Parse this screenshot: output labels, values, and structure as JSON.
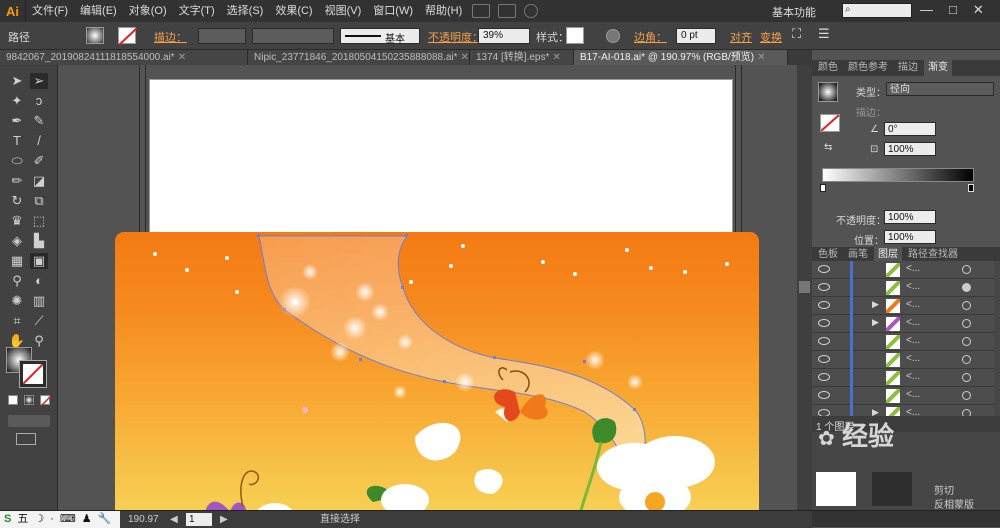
{
  "app": {
    "logo": "Ai"
  },
  "menu": [
    "文件(F)",
    "编辑(E)",
    "对象(O)",
    "文字(T)",
    "选择(S)",
    "效果(C)",
    "视图(V)",
    "窗口(W)",
    "帮助(H)"
  ],
  "workspace": {
    "label": "基本功能"
  },
  "window_controls": [
    "—",
    "□",
    "✕"
  ],
  "control_bar": {
    "object_type": "路径",
    "stroke_label": "描边：",
    "stroke_style": "基本",
    "opacity_label": "不透明度：",
    "opacity_value": "39%",
    "style_label": "样式：",
    "corner_label": "边角：",
    "corner_value": "0 pt",
    "align_label": "对齐",
    "transform_label": "变换"
  },
  "doc_tabs": [
    {
      "label": "9842067_20190824111818554000.ai*",
      "close": "✕",
      "active": false
    },
    {
      "label": "Nipic_23771846_20180504150235888088.ai*",
      "close": "✕",
      "active": false
    },
    {
      "label": "1374 [转换].eps*",
      "close": "✕",
      "active": false
    },
    {
      "label": "B17-AI-018.ai* @ 190.97% (RGB/预览)",
      "close": "✕",
      "active": true
    }
  ],
  "gradient_panel": {
    "tabs": [
      "颜色",
      "颜色参考",
      "描边",
      "渐变"
    ],
    "type_label": "类型：",
    "type_value": "径向",
    "stroke_label": "描边：",
    "angle_value": "0°",
    "aspect_value": "100%",
    "opacity_label": "不透明度：",
    "opacity_value": "100%",
    "location_label": "位置：",
    "location_value": "100%"
  },
  "layers_panel": {
    "tabs": [
      "色板",
      "画笔",
      "图层",
      "路径查找器"
    ],
    "rows": [
      {
        "name": "<...",
        "color": "#8dbf3e"
      },
      {
        "name": "<...",
        "color": "#8dbf3e"
      },
      {
        "name": "<...",
        "color": "#e97a1a"
      },
      {
        "name": "<...",
        "color": "#b051c4"
      },
      {
        "name": "<...",
        "color": "#8dbf3e"
      },
      {
        "name": "<...",
        "color": "#8dbf3e"
      },
      {
        "name": "<...",
        "color": "#8dbf3e"
      },
      {
        "name": "<...",
        "color": "#8dbf3e"
      },
      {
        "name": "<...",
        "color": "#8dbf3e"
      }
    ],
    "count_label": "1 个图层",
    "bottom_labels": [
      "剪切",
      "反相蒙版"
    ]
  },
  "status_bar": {
    "zoom": "190.97",
    "page": "1",
    "tool": "直接选择"
  },
  "ime": [
    "S",
    "五",
    "☽",
    "·",
    "⌨",
    "♟",
    "🔧"
  ],
  "watermark": "经验",
  "colors": {
    "accent_orange": "#f6a14a",
    "artwork_top": "#f47a13",
    "artwork_bottom": "#f6d65a",
    "layer_bar": "#4c6fd6",
    "panel_bg": "#535353"
  }
}
